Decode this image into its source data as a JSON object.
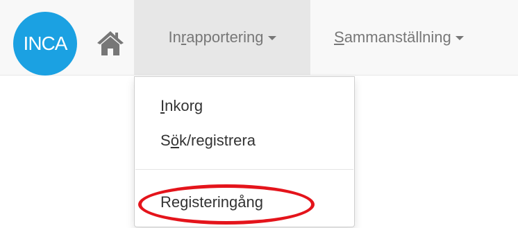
{
  "logo": {
    "text": "INCA",
    "color": "#1ba1e2"
  },
  "nav": {
    "home_icon": "home-icon",
    "menus": [
      {
        "label_pre": "In",
        "label_accel": "r",
        "label_post": "apportering",
        "active": true
      },
      {
        "label_pre": "",
        "label_accel": "S",
        "label_post": "ammanställning",
        "active": false
      }
    ]
  },
  "dropdown": {
    "items": [
      {
        "label_pre": "",
        "label_accel": "I",
        "label_post": "nkorg"
      },
      {
        "label_pre": "S",
        "label_accel": "ö",
        "label_post": "k/registrera"
      },
      {
        "label_pre": "Registeringång",
        "label_accel": "",
        "label_post": ""
      }
    ]
  },
  "annotation": {
    "color": "#e4141b",
    "target": "Registeringång"
  }
}
